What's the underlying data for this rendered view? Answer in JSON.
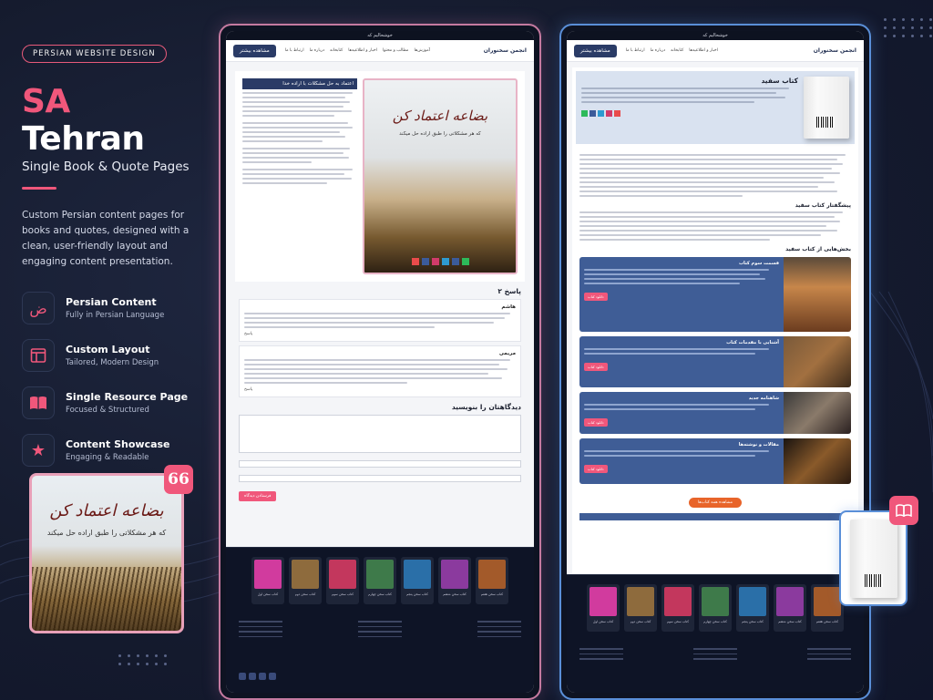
{
  "brand_colors": {
    "accent": "#f0577b",
    "background": "#151b2e",
    "frame_pink": "#c57aa0",
    "frame_blue": "#5a8fd8"
  },
  "hero": {
    "tag": "PERSIAN WEBSITE DESIGN",
    "title_accent": "SA",
    "title_rest": "Tehran",
    "subtitle": "Single Book & Quote Pages",
    "description": "Custom Persian content pages for books and quotes, designed with a clean, user-friendly layout and engaging content presentation."
  },
  "features": [
    {
      "icon": "persian-letter-icon",
      "title": "Persian Content",
      "subtitle": "Fully in Persian Language"
    },
    {
      "icon": "layout-icon",
      "title": "Custom Layout",
      "subtitle": "Tailored, Modern Design"
    },
    {
      "icon": "book-icon",
      "title": "Single Resource Page",
      "subtitle": "Focused & Structured"
    },
    {
      "icon": "star-icon",
      "title": "Content Showcase",
      "subtitle": "Engaging & Readable"
    }
  ],
  "quote_card": {
    "calligraphy": "بضاعه اعتماد کن",
    "caption": "که هر مشکلاتی را طبق اراده حل میکند"
  },
  "quote_badge": "66",
  "quote_page": {
    "topbar": "خوشحالیم که",
    "nav_button": "مشاهده بیشتر",
    "nav_links": [
      "ارتباط با ما",
      "درباره ما",
      "کتابخانه",
      "اخبار و اطلاعیه‌ها",
      "مطالب و محتوا",
      "آموزش‌ها"
    ],
    "logo": "انجمن سخنوران",
    "quote_heading": "اعتماد به حل مشکلات با اراده خدا",
    "quote_calligraphy": "بضاعه اعتماد کن",
    "quote_caption": "که هر مشکلاتی را طبق اراده حل میکند",
    "replies_title": "۲ پاسخ",
    "comment_names": [
      "هاشم",
      "مریمی"
    ],
    "reply_label": "پاسخ",
    "form_title": "دیدگاهتان را بنویسید",
    "submit": "فرستادن دیدگاه"
  },
  "book_page": {
    "topbar": "خوشحالیم که",
    "nav_button": "مشاهده بیشتر",
    "logo": "انجمن سخنوران",
    "book_title": "کتاب سفید",
    "section_intro": "پیشگفتار کتاب سفید",
    "section_articles": "بخش‌هایی از کتاب سفید",
    "articles": [
      "قسمت سوم کتاب",
      "آشنایی با مقدمات کتاب",
      "شاهنامه جدید",
      "مقالات و نوشته‌ها"
    ],
    "article_button": "دانلود کتاب",
    "cta": "مشاهده همه کتاب‌ها"
  },
  "footer_thumbs": [
    {
      "title": "کتاب سخن اول",
      "color": "#d13b9e"
    },
    {
      "title": "کتاب سخن دوم",
      "color": "#8e6b3d"
    },
    {
      "title": "کتاب سخن سوم",
      "color": "#c3375d"
    },
    {
      "title": "کتاب سخن چهارم",
      "color": "#3e7a4a"
    },
    {
      "title": "کتاب سخن پنجم",
      "color": "#2a6fa8"
    },
    {
      "title": "کتاب سخن ششم",
      "color": "#8b3a9e"
    },
    {
      "title": "کتاب سخن هفتم",
      "color": "#a35a2a"
    }
  ]
}
